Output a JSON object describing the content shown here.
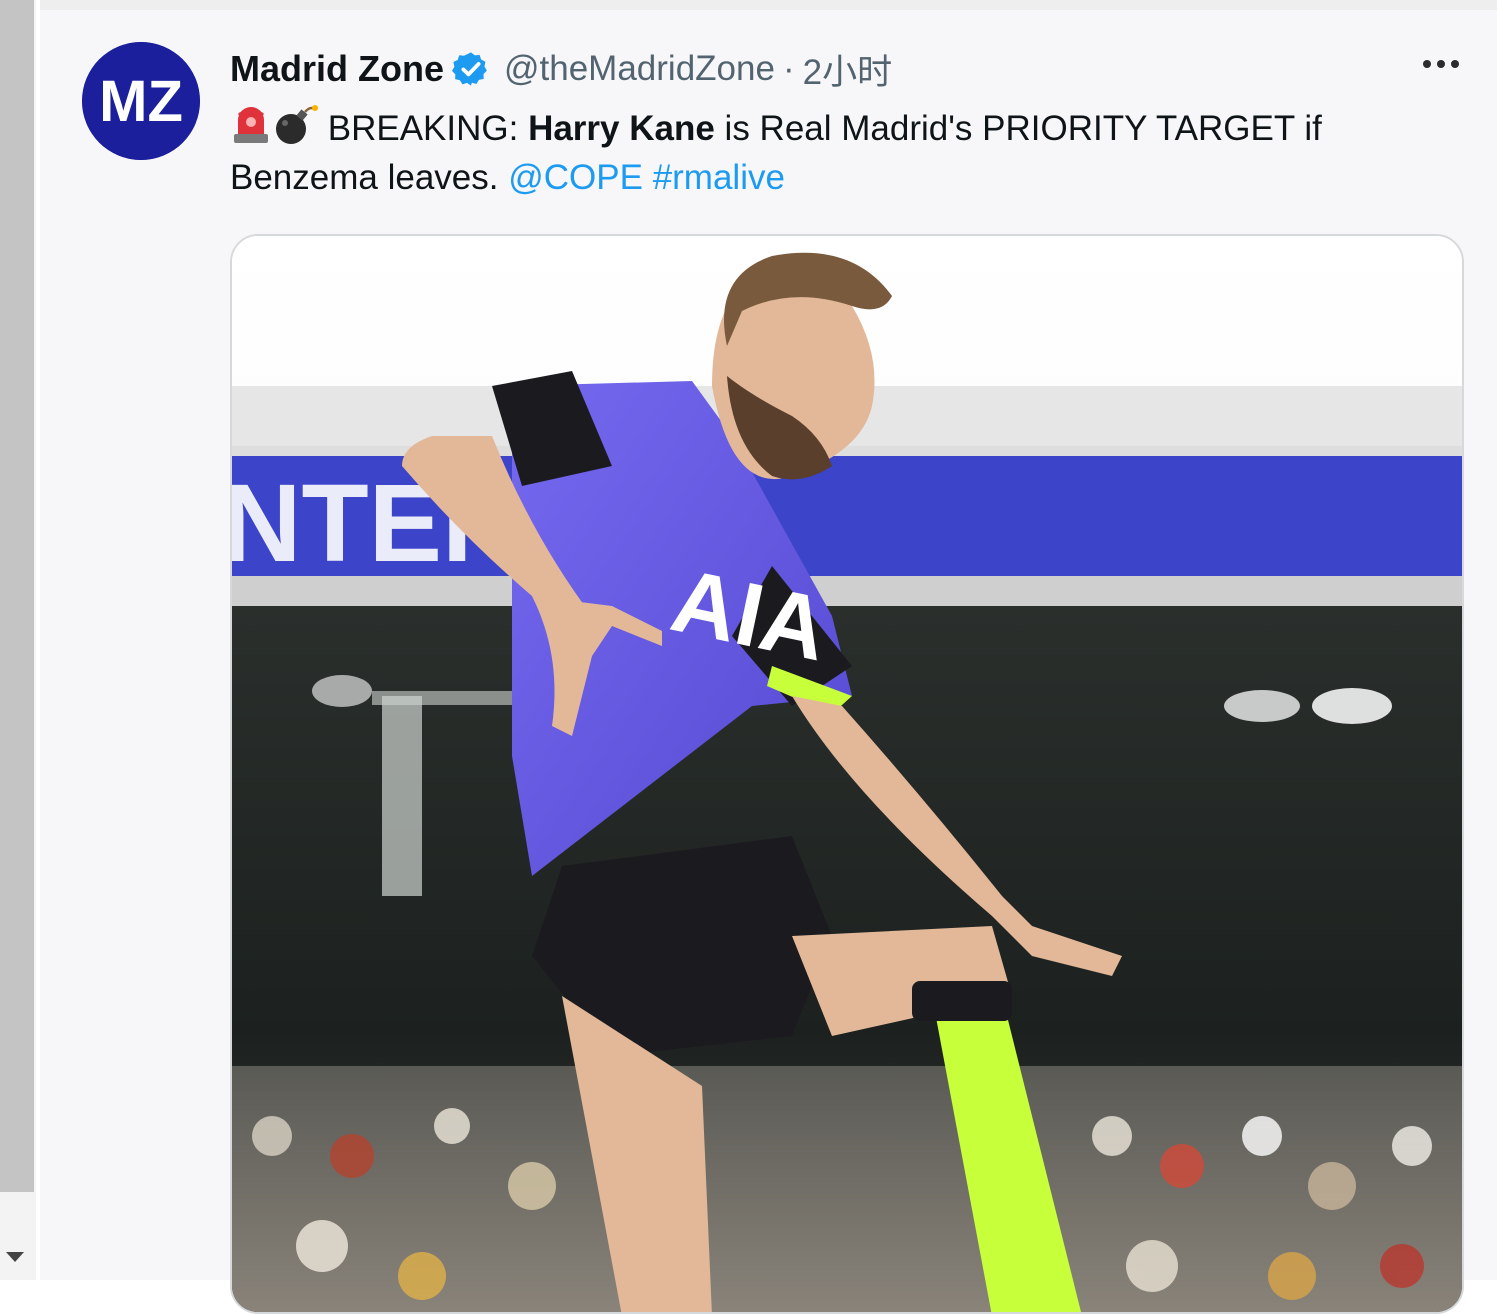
{
  "scrollbar": {
    "visible": true
  },
  "tweet": {
    "author": {
      "name": "Madrid Zone",
      "handle": "@theMadridZone",
      "separator": "·",
      "time": "2小时",
      "avatar_initials": "MZ",
      "verified": true
    },
    "text": {
      "emojis": [
        "police-car-light",
        "bomb"
      ],
      "part1": " BREAKING: ",
      "bold": "Harry Kane",
      "part2": " is Real Madrid's PRIORITY TARGET if Benzema leaves. ",
      "mention": "@COPE",
      "space": " ",
      "hashtag": "#rmalive"
    },
    "media": {
      "jersey_sponsor": "AIA",
      "banner_text": "NTER"
    },
    "colors": {
      "link": "#1d9bf0",
      "verified": "#1d9bf0",
      "avatar_bg": "#1b1f9b",
      "jersey": "#6a60e8",
      "accent_lime": "#c7ff3a"
    }
  }
}
